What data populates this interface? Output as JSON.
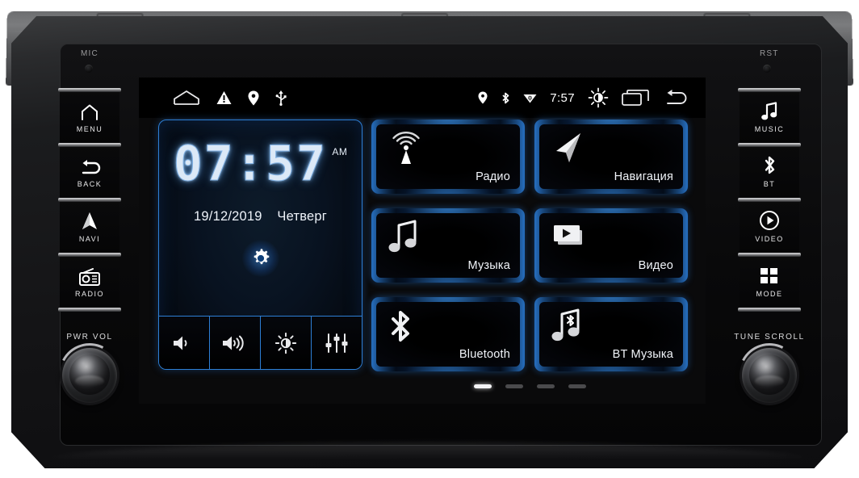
{
  "device": {
    "mic_label": "MIC",
    "reset_label": "RST"
  },
  "hardware": {
    "left_buttons": [
      {
        "icon": "home-icon",
        "label": "MENU"
      },
      {
        "icon": "back-arrow-icon",
        "label": "BACK"
      },
      {
        "icon": "navigation-arrow-icon",
        "label": "NAVI"
      },
      {
        "icon": "radio-icon",
        "label": "RADIO"
      }
    ],
    "right_buttons": [
      {
        "icon": "music-note-icon",
        "label": "MUSIC"
      },
      {
        "icon": "bluetooth-icon",
        "label": "BT"
      },
      {
        "icon": "play-circle-icon",
        "label": "VIDEO"
      },
      {
        "icon": "grid-squares-icon",
        "label": "MODE"
      }
    ],
    "left_knob_label": "PWR  VOL",
    "right_knob_label": "TUNE  SCROLL"
  },
  "statusbar": {
    "left_icons": [
      "home-icon",
      "warning-triangle-icon",
      "location-pin-icon",
      "usb-icon"
    ],
    "right_icons": [
      "location-pin-icon",
      "bluetooth-icon",
      "wifi-signal-icon"
    ],
    "time": "7:57",
    "trailing_icons": [
      "brightness-sun-icon",
      "recents-icon",
      "back-arrow-icon"
    ]
  },
  "clock_widget": {
    "time": "07:57",
    "meridiem": "AM",
    "date": "19/12/2019",
    "weekday": "Четверг",
    "settings_icon": "gear-icon",
    "tools": [
      {
        "icon": "volume-down-icon",
        "name": "volume-down"
      },
      {
        "icon": "volume-up-icon",
        "name": "volume-up"
      },
      {
        "icon": "brightness-sun-icon",
        "name": "brightness"
      },
      {
        "icon": "equalizer-icon",
        "name": "equalizer"
      }
    ]
  },
  "apps": [
    {
      "label": "Радио",
      "icon": "radio-tower-icon"
    },
    {
      "label": "Навигация",
      "icon": "navigation-arrow-icon"
    },
    {
      "label": "Музыка",
      "icon": "music-note-icon"
    },
    {
      "label": "Видео",
      "icon": "video-player-icon"
    },
    {
      "label": "Bluetooth",
      "icon": "bluetooth-icon"
    },
    {
      "label": "BT Музыка",
      "icon": "bluetooth-music-icon"
    }
  ],
  "pager": {
    "count": 4,
    "active": 0
  },
  "colors": {
    "accent_blue": "#2d7fd6",
    "glow_blue": "#3c96f0",
    "screen_black": "#000000",
    "text_white": "#f2f5fa"
  }
}
